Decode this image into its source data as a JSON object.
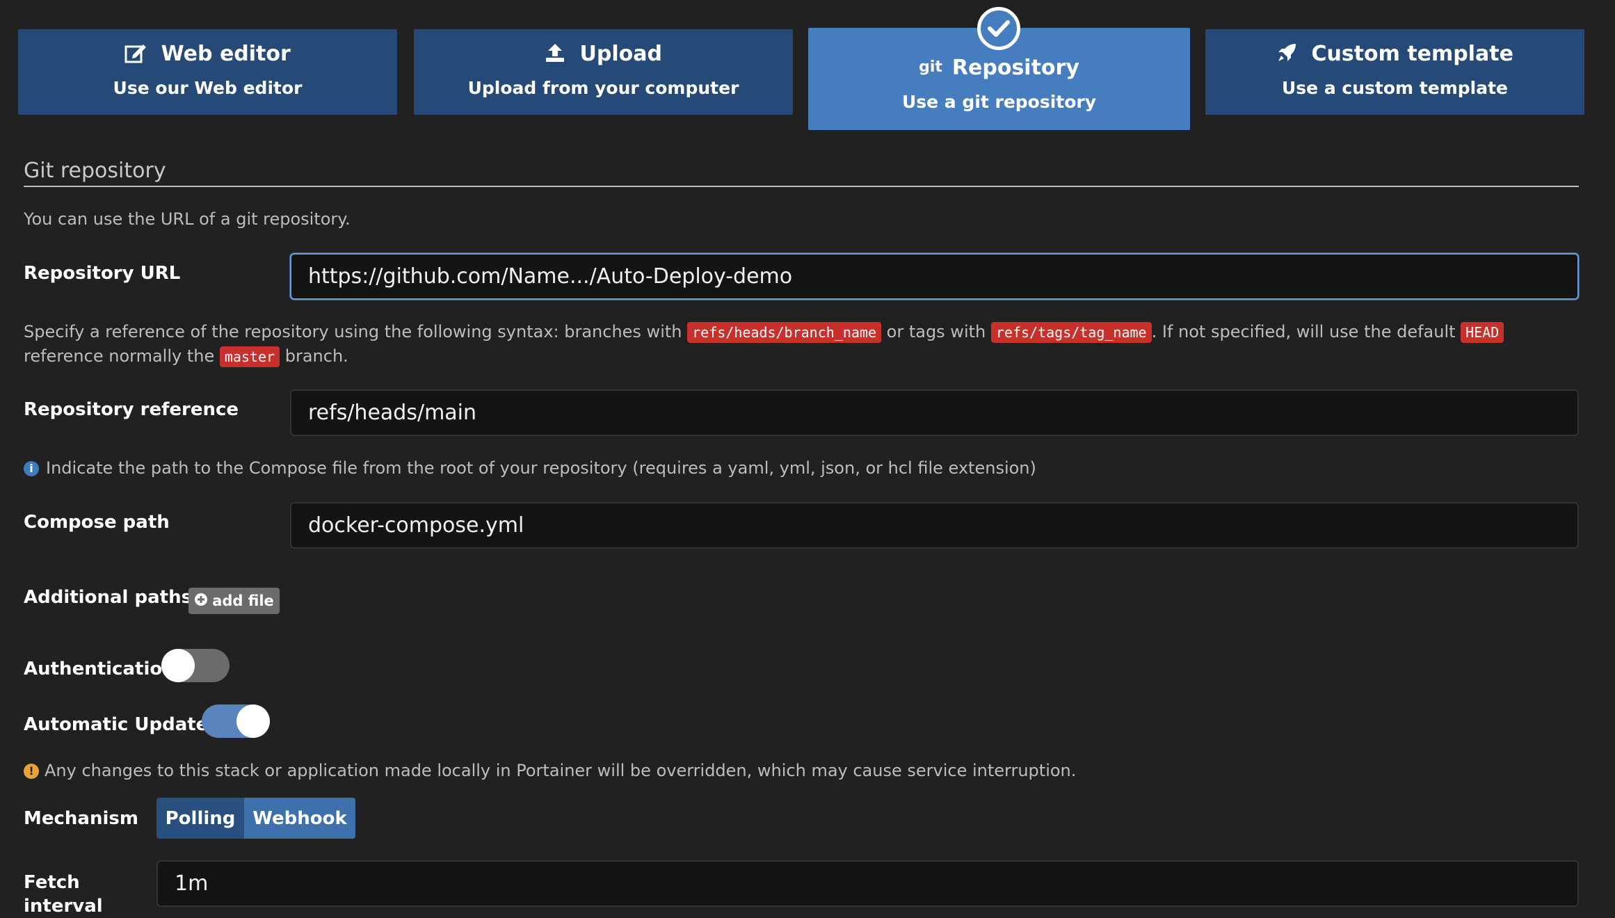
{
  "methods": [
    {
      "title": "Web editor",
      "subtitle": "Use our Web editor",
      "icon": "edit-icon",
      "active": false
    },
    {
      "title": "Upload",
      "subtitle": "Upload from your computer",
      "icon": "upload-icon",
      "active": false
    },
    {
      "title": "Repository",
      "subtitle": "Use a git repository",
      "icon": "git-icon",
      "icon_text": "git",
      "active": true
    },
    {
      "title": "Custom template",
      "subtitle": "Use a custom template",
      "icon": "rocket-icon",
      "active": false
    }
  ],
  "git": {
    "section_title": "Git repository",
    "intro": "You can use the URL of a git repository.",
    "repo_url_label": "Repository URL",
    "repo_url_value": "https://github.com/Name.../Auto-Deploy-demo",
    "ref_help": {
      "part1": "Specify a reference of the repository using the following syntax: branches with ",
      "code1": "refs/heads/branch_name",
      "part2": " or tags with ",
      "code2": "refs/tags/tag_name",
      "part3": ". If not specified, will use the default ",
      "code3": "HEAD",
      "part4": "reference normally the ",
      "code4": "master",
      "part5": " branch."
    },
    "repo_ref_label": "Repository reference",
    "repo_ref_value": "refs/heads/main",
    "compose_help": "Indicate the path to the Compose file from the root of your repository (requires a yaml, yml, json, or hcl file extension)",
    "compose_label": "Compose path",
    "compose_value": "docker-compose.yml",
    "additional_label": "Additional paths",
    "add_file_label": "add file",
    "auth_label": "Authentication",
    "auth_on": false,
    "auto_update_label": "Automatic Updates",
    "auto_update_on": true,
    "warning": "Any changes to this stack or application made locally in Portainer will be overridden, which may cause service interruption.",
    "mechanism_label": "Mechanism",
    "mechanism_options": [
      "Polling",
      "Webhook"
    ],
    "mechanism_selected": "Polling",
    "fetch_label_line1": "Fetch",
    "fetch_label_line2": "interval",
    "fetch_value": "1m"
  },
  "colors": {
    "tile": "#264a78",
    "tile_active": "#467dbf",
    "code_tag": "#c9302c",
    "info": "#3f7bbf",
    "warning": "#e8a23a"
  }
}
